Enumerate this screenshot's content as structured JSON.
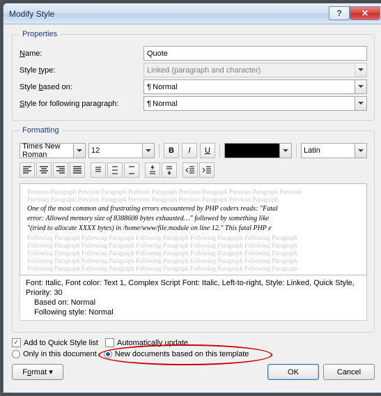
{
  "window": {
    "title": "Modify Style"
  },
  "properties": {
    "legend": "Properties",
    "name_label": "Name:",
    "name_value": "Quote",
    "type_label": "Style type:",
    "type_value": "Linked (paragraph and character)",
    "based_label": "Style based on:",
    "based_value": "Normal",
    "following_label": "Style for following paragraph:",
    "following_value": "Normal"
  },
  "formatting": {
    "legend": "Formatting",
    "font": "Times New Roman",
    "size": "12",
    "language": "Latin",
    "preview_grey": "Previous Paragraph Previous Paragraph Previous Paragraph Previous Paragraph Previous Paragraph Previous",
    "preview_grey2": "Previous Paragraph Previous Paragraph Previous Paragraph Previous Paragraph Previous Paragraph",
    "sample1": "One of the most common and frustrating errors encountered by PHP coders reads: \"Fatal",
    "sample2": "error: Allowed memory size of 8388608 bytes exhausted…\" followed by something like",
    "sample3": "\"(tried to allocate XXXX bytes) in /home/www/file.module on line 12.\" This fatal PHP e",
    "following_grey": "Following Paragraph Following Paragraph Following Paragraph Following Paragraph Following Paragraph",
    "desc1": "Font: Italic, Font color: Text 1, Complex Script Font: Italic, Left-to-right, Style: Linked, Quick Style,",
    "desc2": "Priority: 30",
    "desc3": "Based on: Normal",
    "desc4": "Following style: Normal"
  },
  "options": {
    "quick_list": "Add to Quick Style list",
    "auto_update": "Automatically update",
    "only_doc": "Only in this document",
    "new_docs": "New documents based on this template"
  },
  "buttons": {
    "format": "Format",
    "ok": "OK",
    "cancel": "Cancel"
  }
}
